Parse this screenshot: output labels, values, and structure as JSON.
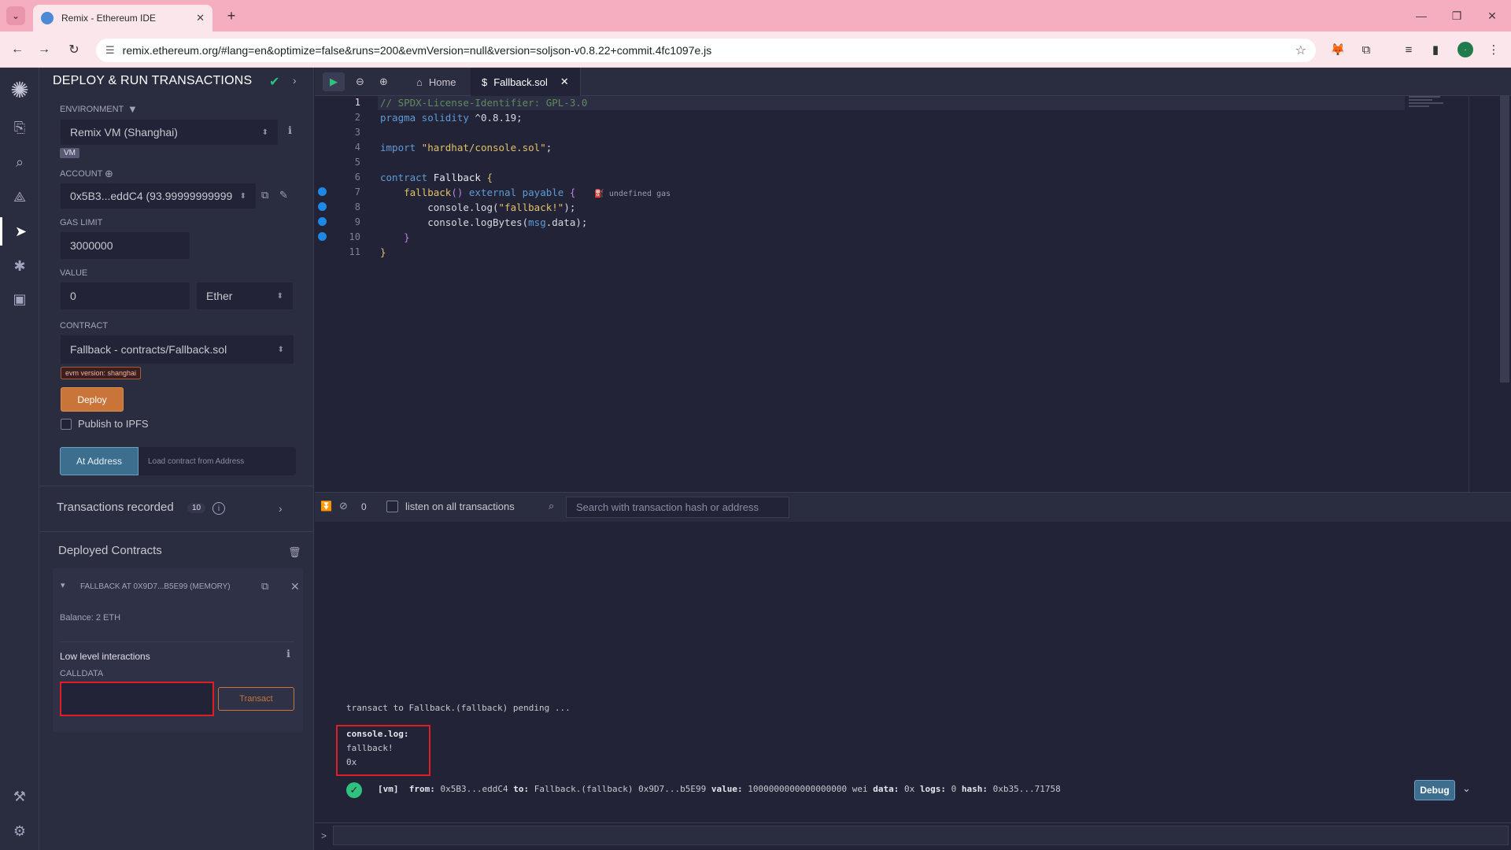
{
  "browser": {
    "tab_title": "Remix - Ethereum IDE",
    "url": "remix.ethereum.org/#lang=en&optimize=false&runs=200&evmVersion=null&version=soljson-v0.8.22+commit.4fc1097e.js",
    "profile_initial": "·"
  },
  "sidepanel": {
    "title": "DEPLOY & RUN TRANSACTIONS",
    "environment_label": "ENVIRONMENT",
    "environment_value": "Remix VM (Shanghai)",
    "vm_badge": "VM",
    "account_label": "ACCOUNT",
    "account_value": "0x5B3...eddC4 (93.99999999999",
    "gas_limit_label": "GAS LIMIT",
    "gas_limit_value": "3000000",
    "value_label": "VALUE",
    "value_amount": "0",
    "value_unit": "Ether",
    "contract_label": "CONTRACT",
    "contract_value": "Fallback - contracts/Fallback.sol",
    "evm_badge": "evm version: shanghai",
    "deploy_label": "Deploy",
    "publish_ipfs_label": "Publish to IPFS",
    "at_address_label": "At Address",
    "load_address_placeholder": "Load contract from Address",
    "transactions_recorded_label": "Transactions recorded",
    "transactions_recorded_count": "10",
    "deployed_contracts_label": "Deployed Contracts",
    "instance_title": "FALLBACK AT 0X9D7...B5E99 (MEMORY)",
    "instance_balance": "Balance: 2 ETH",
    "low_level_label": "Low level interactions",
    "calldata_label": "CALLDATA",
    "transact_label": "Transact"
  },
  "editor": {
    "home_tab": "Home",
    "file_tab": "Fallback.sol",
    "line_numbers": [
      "1",
      "2",
      "3",
      "4",
      "5",
      "6",
      "7",
      "8",
      "9",
      "10",
      "11"
    ],
    "gas_hint": "undefined gas"
  },
  "terminal": {
    "pending_count": "0",
    "listen_label": "listen on all transactions",
    "search_placeholder": "Search with transaction hash or address",
    "pending_message": "transact to Fallback.(fallback) pending ...",
    "log_title": "console.log:",
    "log_line_1": "fallback!",
    "log_line_2": "0x",
    "tx": {
      "tag": "[vm]",
      "from_label": "from:",
      "from": "0x5B3...eddC4",
      "to_label": "to:",
      "to": "Fallback.(fallback) 0x9D7...b5E99",
      "value_label": "value:",
      "value": "1000000000000000000 wei",
      "data_label": "data:",
      "data": "0x",
      "logs_label": "logs:",
      "logs": "0",
      "hash_label": "hash:",
      "hash": "0xb35...71758"
    },
    "debug_label": "Debug",
    "prompt": ">"
  },
  "colors": {
    "accent_deploy": "#c97539",
    "accent_blue": "#3e6e8e",
    "success": "#2ec27e",
    "highlight_box": "#e01c24",
    "breakpoint": "#1e88e5"
  }
}
